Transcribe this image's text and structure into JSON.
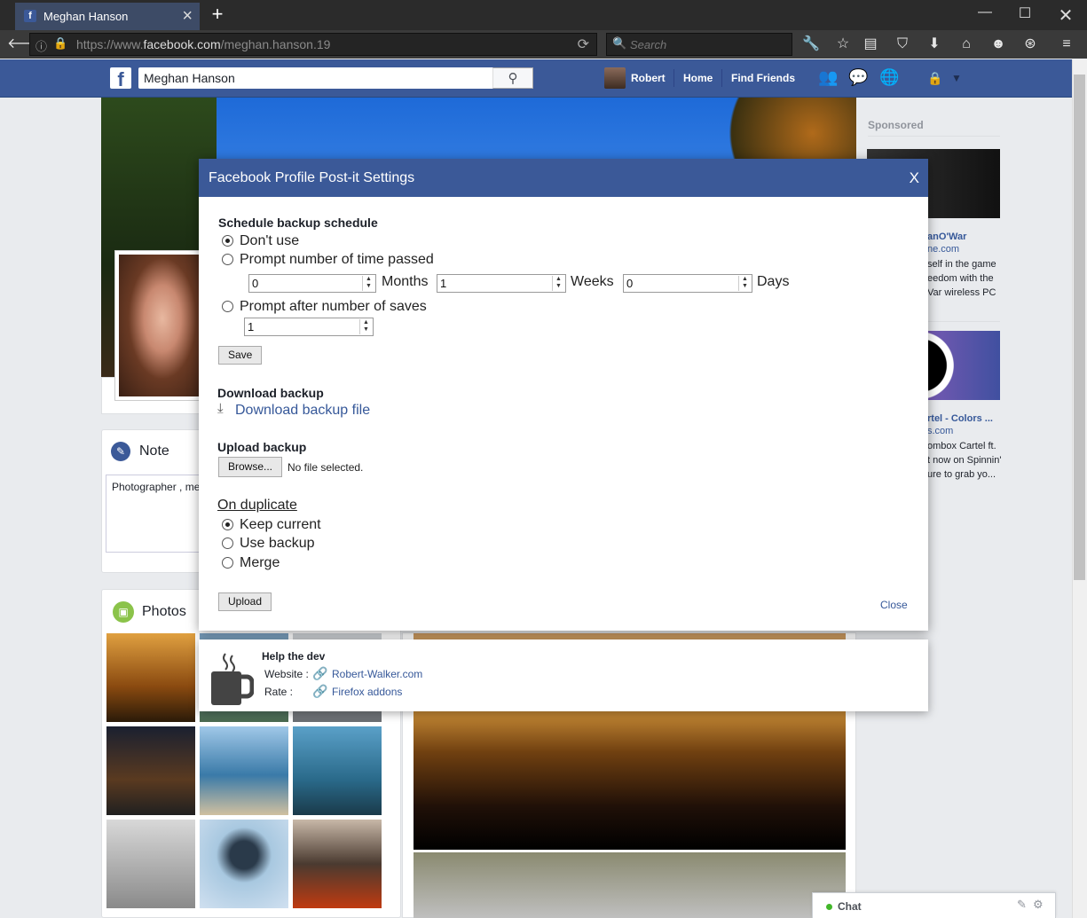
{
  "browser": {
    "tab_title": "Meghan Hanson",
    "url_domain_pre": "https://www.",
    "url_domain": "facebook.com",
    "url_path": "/meghan.hanson.19",
    "search_placeholder": "Search"
  },
  "facebook": {
    "search_value": "Meghan Hanson",
    "user_name": "Robert",
    "nav_home": "Home",
    "nav_find_friends": "Find Friends",
    "note_title": "Note",
    "note_text": "Photographer , me",
    "photos_title": "Photos",
    "sponsored": "Sponsored",
    "ad1": {
      "title": "anO'War",
      "url": "ne.com",
      "lines": [
        "self in the game",
        "eedom with the",
        "Var wireless PC"
      ]
    },
    "ad2": {
      "title": "rtel - Colors ...",
      "url": "s.com",
      "lines": [
        "ombox Cartel ft.",
        "t now on Spinnin'",
        "ure to grab yo..."
      ]
    },
    "chat_label": "Chat"
  },
  "dialog": {
    "title": "Facebook Profile Post-it Settings",
    "close_x": "X",
    "schedule_heading": "Schedule backup schedule",
    "opt_dont_use": "Don't use",
    "opt_prompt_time": "Prompt number of time passed",
    "months_value": "0",
    "months_label": "Months",
    "weeks_value": "1",
    "weeks_label": "Weeks",
    "days_value": "0",
    "days_label": "Days",
    "opt_prompt_saves": "Prompt after number of saves",
    "saves_value": "1",
    "save_button": "Save",
    "download_heading": "Download backup",
    "download_link": "Download backup file",
    "upload_heading": "Upload backup",
    "browse_button": "Browse...",
    "no_file": "No file selected.",
    "duplicate_heading": "On duplicate",
    "dup_keep": "Keep current",
    "dup_backup": "Use backup",
    "dup_merge": "Merge",
    "upload_button": "Upload",
    "close_link": "Close"
  },
  "help": {
    "heading": "Help the dev",
    "website_label": "Website :",
    "website_link": "Robert-Walker.com",
    "rate_label": "Rate :",
    "rate_link": "Firefox addons"
  }
}
